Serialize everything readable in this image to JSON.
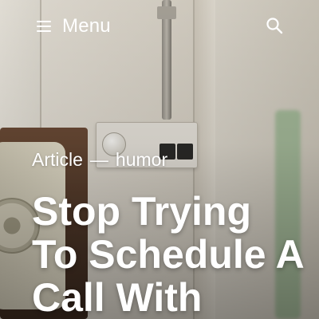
{
  "header": {
    "menu_label": "Menu",
    "menu_icon": "hamburger-icon",
    "search_icon": "search-icon"
  },
  "article": {
    "type_label": "Article",
    "separator": "—",
    "category": "humor",
    "title": "Stop Trying To Schedule A Call With"
  },
  "colors": {
    "text": "#ffffff",
    "accent_green": "#98b48f"
  }
}
